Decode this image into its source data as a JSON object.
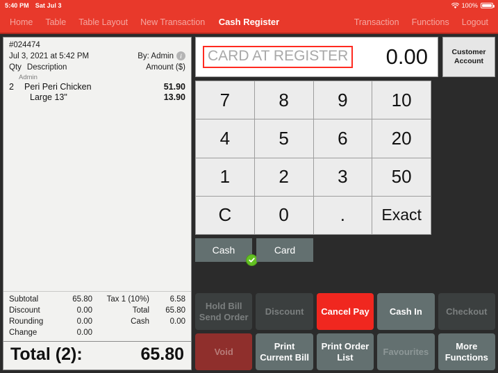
{
  "statusbar": {
    "time": "5:40 PM",
    "date": "Sat Jul 3",
    "battery_percent": "100%",
    "wifi_icon": "wifi-icon",
    "battery_icon": "battery-icon"
  },
  "navbar": {
    "title": "Cash Register",
    "left_items": [
      {
        "label": "Home"
      },
      {
        "label": "Table"
      },
      {
        "label": "Table Layout"
      },
      {
        "label": "New Transaction"
      }
    ],
    "right_items": [
      {
        "label": "Transaction"
      },
      {
        "label": "Functions"
      },
      {
        "label": "Logout"
      }
    ],
    "bar_color": "#e8392b"
  },
  "receipt": {
    "order_number": "#024474",
    "datetime": "Jul 3, 2021 at 5:42 PM",
    "operator": "By: Admin",
    "info_icon": "info-icon",
    "col_qty": "Qty",
    "col_description": "Description",
    "col_amount": "Amount ($)",
    "group_label": "Admin",
    "items": [
      {
        "qty": "2",
        "description": "Peri Peri Chicken",
        "amount": "51.90",
        "child": false
      },
      {
        "qty": "",
        "description": "Large 13\"",
        "amount": "13.90",
        "child": true
      }
    ],
    "totals": [
      {
        "label": "Subtotal",
        "value": "65.80",
        "label2": "Tax 1 (10%)",
        "value2": "6.58"
      },
      {
        "label": "Discount",
        "value": "0.00",
        "label2": "Total",
        "value2": "65.80"
      },
      {
        "label": "Rounding",
        "value": "0.00",
        "label2": "Cash",
        "value2": "0.00"
      },
      {
        "label": "Change",
        "value": "0.00",
        "label2": "",
        "value2": ""
      }
    ],
    "grand_label": "Total (2):",
    "grand_value": "65.80"
  },
  "register": {
    "display_label": "CARD AT REGISTER",
    "display_label_highlight": "#ff2a20",
    "display_amount": "0.00",
    "customer_account": "Customer\nAccount",
    "customer_account_line1": "Customer",
    "customer_account_line2": "Account",
    "keypad": [
      {
        "label": "7"
      },
      {
        "label": "8"
      },
      {
        "label": "9"
      },
      {
        "label": "10"
      },
      {
        "label": "4"
      },
      {
        "label": "5"
      },
      {
        "label": "6"
      },
      {
        "label": "20"
      },
      {
        "label": "1"
      },
      {
        "label": "2"
      },
      {
        "label": "3"
      },
      {
        "label": "50"
      },
      {
        "label": "C"
      },
      {
        "label": "0"
      },
      {
        "label": "."
      },
      {
        "label": "Exact"
      }
    ],
    "pay_types": [
      {
        "label": "Cash",
        "selected": true,
        "check_icon": "check-circle-icon"
      },
      {
        "label": "Card",
        "selected": false
      }
    ],
    "actions": [
      {
        "label": "Hold Bill\nSend Order",
        "line1": "Hold Bill",
        "line2": "Send Order",
        "style": "dark"
      },
      {
        "label": "Discount",
        "line1": "Discount",
        "line2": "",
        "style": "dark"
      },
      {
        "label": "Cancel Pay",
        "line1": "Cancel Pay",
        "line2": "",
        "style": "red"
      },
      {
        "label": "Cash In",
        "line1": "Cash In",
        "line2": "",
        "style": "gray"
      },
      {
        "label": "Checkout",
        "line1": "Checkout",
        "line2": "",
        "style": "dark"
      },
      {
        "label": "Void",
        "line1": "Void",
        "line2": "",
        "style": "darkred"
      },
      {
        "label": "Print\nCurrent Bill",
        "line1": "Print",
        "line2": "Current Bill",
        "style": "gray"
      },
      {
        "label": "Print Order\nList",
        "line1": "Print Order",
        "line2": "List",
        "style": "gray"
      },
      {
        "label": "Favourites",
        "line1": "Favourites",
        "line2": "",
        "style": "graydim"
      },
      {
        "label": "More\nFunctions",
        "line1": "More",
        "line2": "Functions",
        "style": "gray"
      }
    ]
  }
}
